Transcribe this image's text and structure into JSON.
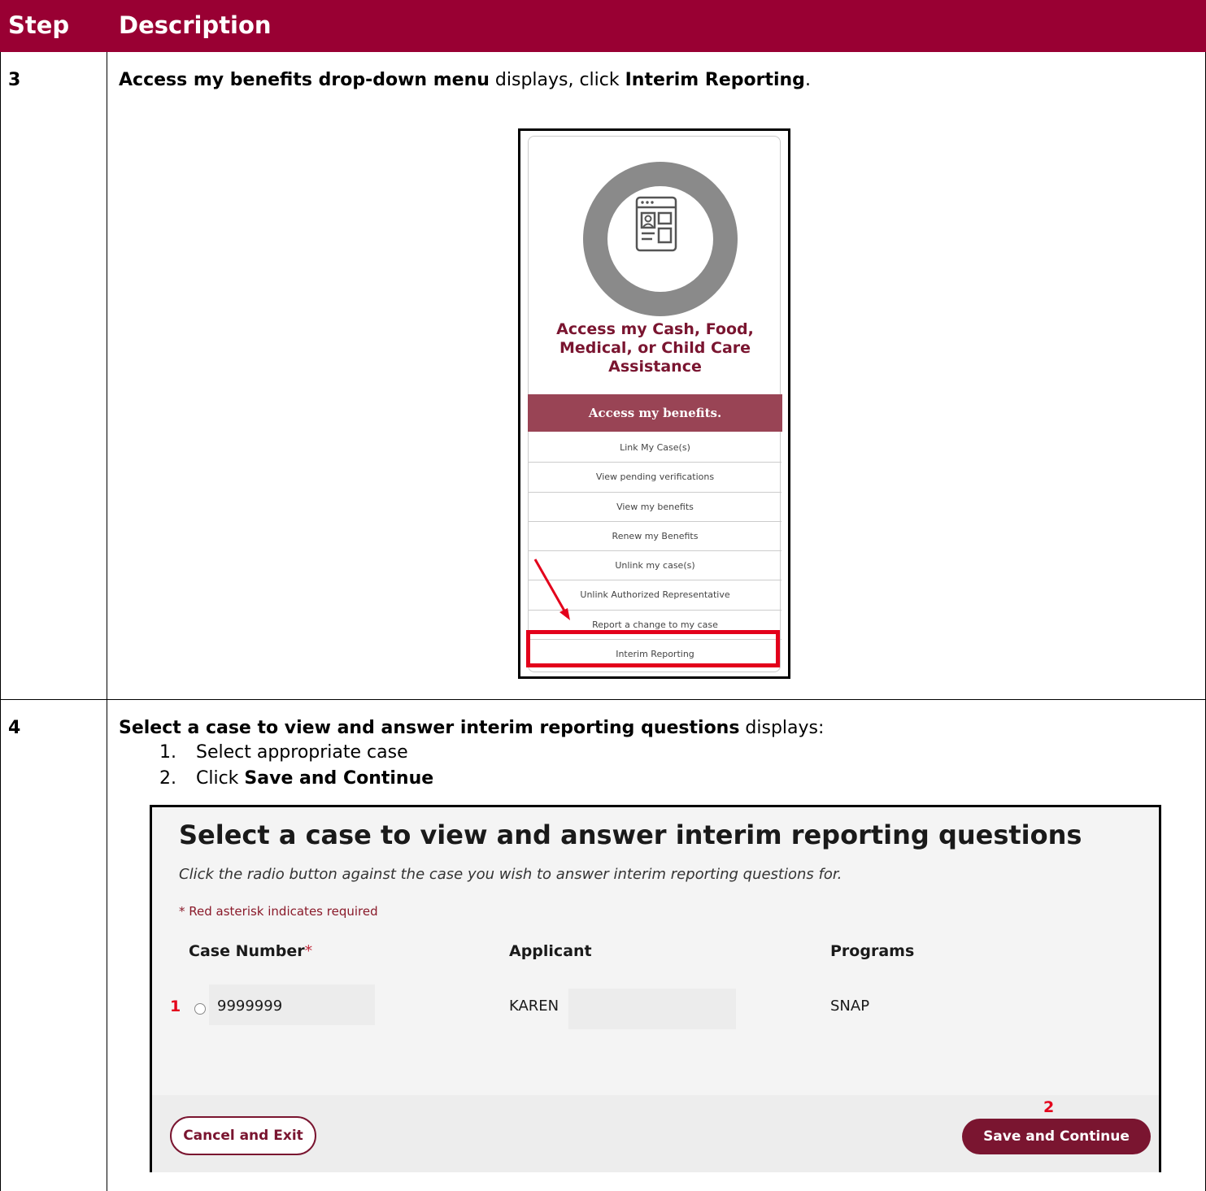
{
  "header": {
    "step_label": "Step",
    "description_label": "Description"
  },
  "colors": {
    "header_bg": "#990033",
    "brand_maroon": "#7a1530",
    "highlight_red": "#e3001b"
  },
  "step3": {
    "number": "3",
    "instruction_bold1": "Access my benefits drop-down menu",
    "instruction_plain1": " displays, click ",
    "instruction_bold2": "Interim Reporting",
    "instruction_plain2": ".",
    "screenshot": {
      "icon": "browser-window-profile-icon",
      "title_lines": [
        "Access my Cash, Food,",
        "Medical, or Child Care",
        "Assistance"
      ],
      "access_button": "Access my benefits.",
      "menu_items": [
        "Link My Case(s)",
        "View pending verifications",
        "View my benefits",
        "Renew my Benefits",
        "Unlink my case(s)",
        "Unlink Authorized Representative",
        "Report a change to my case",
        "Interim Reporting"
      ]
    }
  },
  "step4": {
    "number": "4",
    "instruction_bold": "Select a case to view and answer interim reporting questions",
    "instruction_plain": " displays:",
    "substeps": [
      {
        "num": "1.",
        "plain": "Select appropriate case",
        "bold": ""
      },
      {
        "num": "2.",
        "plain": "Click ",
        "bold": "Save and Continue"
      }
    ],
    "screenshot": {
      "title": "Select a case to view and answer interim reporting questions",
      "subtitle": "Click the radio button against the case you wish to answer interim reporting questions for.",
      "required_note": "* Red asterisk indicates required",
      "columns": {
        "case_number": "Case Number",
        "required_mark": "*",
        "applicant": "Applicant",
        "programs": "Programs"
      },
      "row": {
        "case_number": "9999999",
        "applicant": "KAREN",
        "programs": "SNAP"
      },
      "marker1": "1",
      "marker2": "2",
      "cancel_button": "Cancel and Exit",
      "save_button": "Save and Continue"
    }
  }
}
